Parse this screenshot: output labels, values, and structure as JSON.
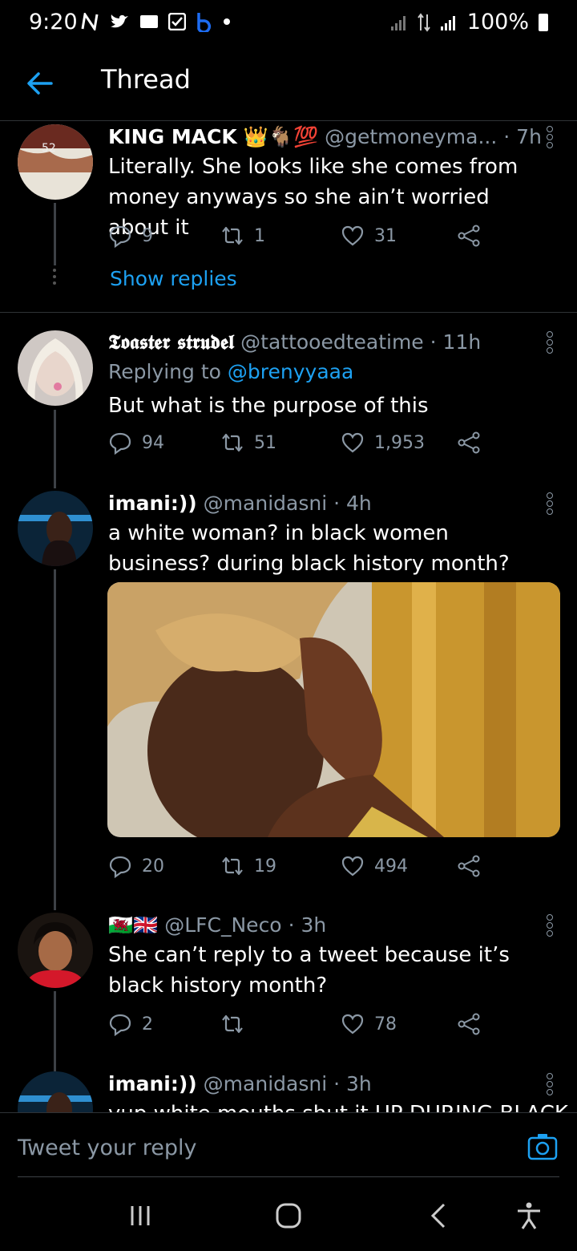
{
  "status_bar": {
    "time": "9:20",
    "battery": "100%"
  },
  "header": {
    "title": "Thread"
  },
  "tweets": [
    {
      "display_name": "KING MACK",
      "name_emojis": "👑🐐💯",
      "handle": "@getmoneyma...",
      "time": "· 7h",
      "text": "Literally. She looks like she comes from money anyways so she ain’t worried about it",
      "replies": "9",
      "retweets": "1",
      "likes": "31",
      "show_replies": "Show replies"
    },
    {
      "display_name": "𝕿𝖔𝖆𝖘𝖙𝖊𝖗 𝖘𝖙𝖗𝖚𝖉𝖊𝖑",
      "handle": "@tattooedteatime",
      "time": "· 11h",
      "replying_prefix": "Replying to",
      "replying_to": "@brenyyaaa",
      "text": "But what is the purpose of this",
      "replies": "94",
      "retweets": "51",
      "likes": "1,953"
    },
    {
      "display_name": "imani:))",
      "handle": "@manidasni",
      "time": "· 4h",
      "text": "a white woman? in black women business? during black history month?",
      "replies": "20",
      "retweets": "19",
      "likes": "494"
    },
    {
      "display_name": "🏴󠁧󠁢󠁷󠁬󠁳󠁿🇬🇧",
      "handle": "@LFC_Neco",
      "time": "· 3h",
      "text": "She can’t reply to a tweet because it’s black history month?",
      "replies": "2",
      "retweets": "",
      "likes": "78"
    },
    {
      "display_name": "imani:))",
      "handle": "@manidasni",
      "time": "· 3h",
      "text": "yup white mouths shut it UP DURING BLACK"
    }
  ],
  "reply_bar": {
    "placeholder": "Tweet your reply"
  },
  "colors": {
    "accent": "#1da1f2",
    "muted": "#8b98a5",
    "background": "#000000"
  },
  "icons": [
    "back-arrow-icon",
    "more-icon",
    "reply-icon",
    "retweet-icon",
    "like-icon",
    "share-icon",
    "camera-icon",
    "recents-icon",
    "home-icon",
    "back-icon",
    "accessibility-icon"
  ]
}
